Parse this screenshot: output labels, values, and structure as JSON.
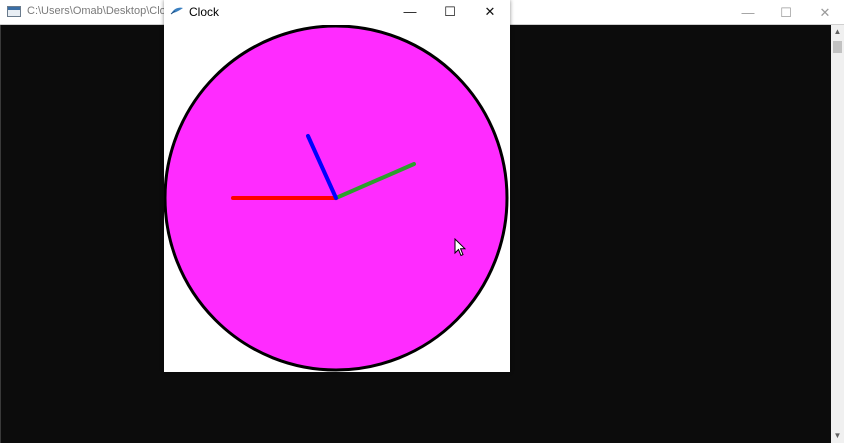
{
  "console_window": {
    "title": "C:\\Users\\Omab\\Desktop\\Clock",
    "controls": {
      "minimize": "—",
      "maximize": "☐",
      "close": "✕"
    },
    "scroll_up": "▲",
    "scroll_down": "▼"
  },
  "clock_window": {
    "title": "Clock",
    "controls": {
      "minimize": "—",
      "maximize": "☐",
      "close": "✕"
    },
    "face_color": "#ff2bff",
    "rim_color": "#000000",
    "hand_colors": {
      "hour": "#0000ff",
      "minute": "#2ca02c",
      "second": "#ff0000"
    }
  }
}
